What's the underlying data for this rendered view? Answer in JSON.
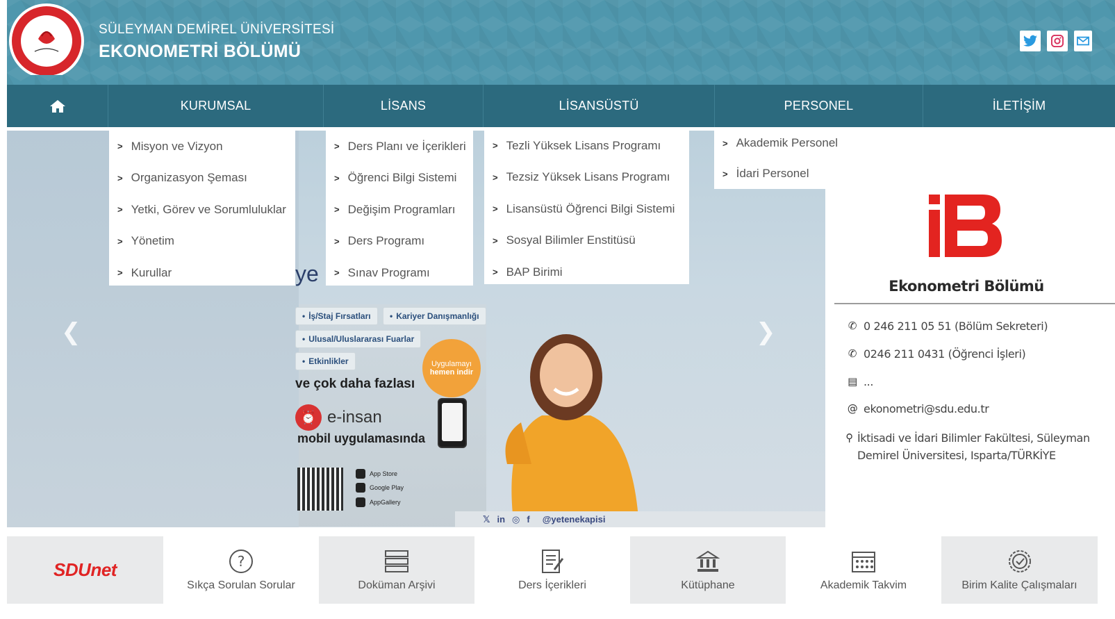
{
  "header": {
    "university": "SÜLEYMAN DEMİREL ÜNİVERSİTESİ",
    "department": "EKONOMETRİ BÖLÜMÜ",
    "social": [
      "twitter-icon",
      "instagram-icon",
      "mail-icon"
    ],
    "colors": {
      "header_bg": "#4f97ad",
      "nav_bg": "#2c6a7e",
      "logo_red": "#d7262b"
    }
  },
  "nav": {
    "items": [
      "KURUMSAL",
      "LİSANS",
      "LİSANSÜSTÜ",
      "PERSONEL",
      "İLETİŞİM"
    ]
  },
  "menus": {
    "kurumsal": [
      "Misyon ve Vizyon",
      "Organizasyon Şeması",
      "Yetki, Görev ve Sorumluluklar",
      "Yönetim",
      "Kurullar"
    ],
    "lisans": [
      "Ders Planı ve İçerikleri",
      "Öğrenci Bilgi Sistemi",
      "Değişim Programları",
      "Ders Programı",
      "Sınav Programı"
    ],
    "lisansustu": [
      "Tezli Yüksek Lisans Programı",
      "Tezsiz Yüksek Lisans Programı",
      "Lisansüstü Öğrenci Bilgi Sistemi",
      "Sosyal Bilimler Enstitüsü",
      "BAP Birimi"
    ],
    "personel": [
      "Akademik Personel",
      "İdari Personel"
    ]
  },
  "slider": {
    "partial_text": "ye",
    "chips": [
      "İş/Staj Fırsatları",
      "Kariyer Danışmanlığı",
      "Ulusal/Uluslararası Fuarlar",
      "Etkinlikler"
    ],
    "more": "ve çok daha fazlası",
    "app_name": "e-insan",
    "app_line": "mobil uygulamasında",
    "badge_top": "Uygulamayı",
    "badge_bottom": "hemen indir",
    "stores": [
      "App Store",
      "Google Play",
      "AppGallery"
    ],
    "handle": "@yetenekapisi"
  },
  "info": {
    "title": "Ekonometri Bölümü",
    "phone1": "0 246 211 05 51 (Bölüm Sekreteri)",
    "phone2": "0246 211 0431 (Öğrenci İşleri)",
    "fax": "...",
    "email": "ekonometri@sdu.edu.tr",
    "address": "İktisadi ve İdari Bilimler Fakültesi, Süleyman Demirel Üniversitesi, Isparta/TÜRKİYE"
  },
  "quick_links": {
    "sdunet": "SDUnet",
    "items": [
      "Sıkça Sorulan Sorular",
      "Doküman Arşivi",
      "Ders İçerikleri",
      "Kütüphane",
      "Akademik Takvim",
      "Birim Kalite Çalışmaları"
    ]
  }
}
